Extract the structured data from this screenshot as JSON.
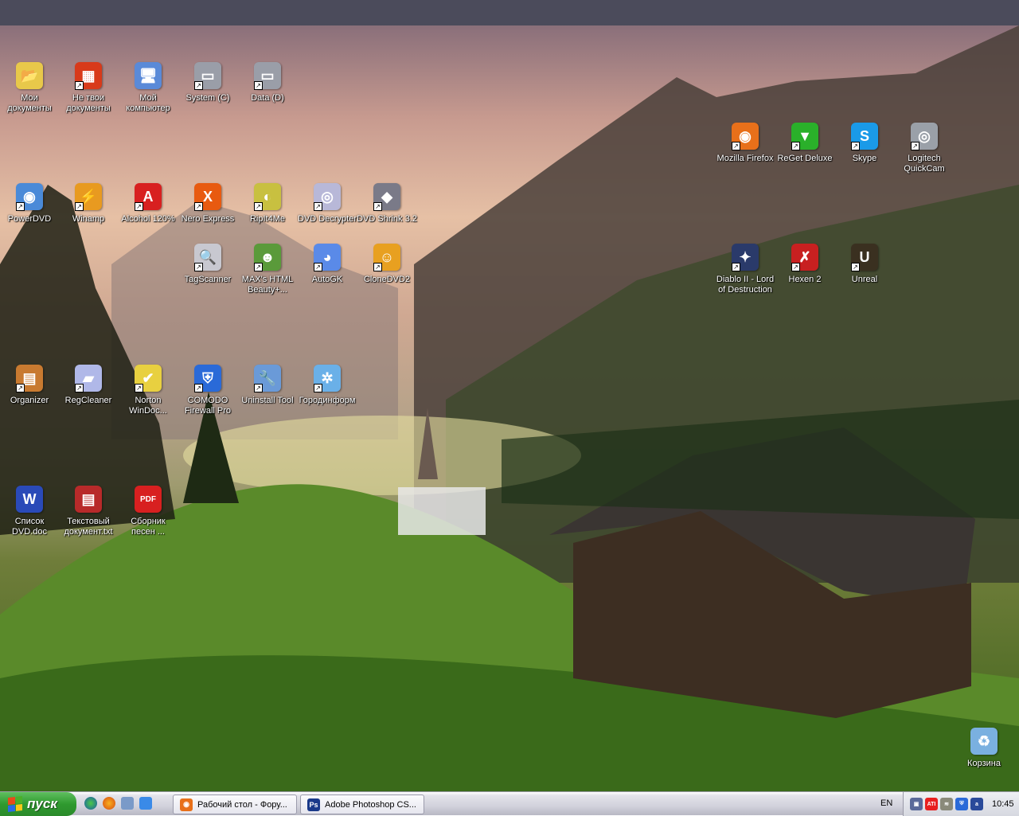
{
  "desktop_icons": [
    {
      "label": "Мои\nдокументы",
      "glyph": "📂",
      "color": "#e8c84a",
      "shortcut": false
    },
    {
      "label": "Не твои\nдокументы",
      "glyph": "▦",
      "color": "#d83a1a",
      "shortcut": true
    },
    {
      "label": "Мой\nкомпьютер",
      "glyph": "🖥",
      "color": "#5a8ad8",
      "shortcut": false
    },
    {
      "label": "System (C)",
      "glyph": "▭",
      "color": "#9a9ea8",
      "shortcut": true
    },
    {
      "label": "Data (D)",
      "glyph": "▭",
      "color": "#9a9ea8",
      "shortcut": true
    },
    {
      "label": "PowerDVD",
      "glyph": "◉",
      "color": "#4a8ad8",
      "shortcut": true
    },
    {
      "label": "Winamp",
      "glyph": "⚡",
      "color": "#e89a20",
      "shortcut": true
    },
    {
      "label": "Alcohol 120%",
      "glyph": "A",
      "color": "#d82020",
      "shortcut": true
    },
    {
      "label": "Nero Express",
      "glyph": "X",
      "color": "#e85a10",
      "shortcut": true
    },
    {
      "label": "RipIt4Me",
      "glyph": "◐",
      "color": "#c8c040",
      "shortcut": true
    },
    {
      "label": "DVD Decrypter",
      "glyph": "◎",
      "color": "#b8b8d8",
      "shortcut": true
    },
    {
      "label": "DVD Shrink 3.2",
      "glyph": "◆",
      "color": "#7a7a88",
      "shortcut": true
    },
    {
      "label": "TagScanner",
      "glyph": "🔍",
      "color": "#c8c8d0",
      "shortcut": true
    },
    {
      "label": "MAX's HTML\nBeauty+...",
      "glyph": "☻",
      "color": "#5a9a3a",
      "shortcut": true
    },
    {
      "label": "AutoGK",
      "glyph": "◕",
      "color": "#5a8ae8",
      "shortcut": true
    },
    {
      "label": "CloneDVD2",
      "glyph": "☺",
      "color": "#e8a020",
      "shortcut": true
    },
    {
      "label": "Organizer",
      "glyph": "▤",
      "color": "#c87a30",
      "shortcut": true
    },
    {
      "label": "RegCleaner",
      "glyph": "▰",
      "color": "#b0b8e8",
      "shortcut": true
    },
    {
      "label": "Norton\nWinDoc...",
      "glyph": "✔",
      "color": "#e8d040",
      "shortcut": true
    },
    {
      "label": "COMODO\nFirewall Pro",
      "glyph": "⛨",
      "color": "#2a6ad8",
      "shortcut": true
    },
    {
      "label": "Uninstall Tool",
      "glyph": "🔧",
      "color": "#6a9ad8",
      "shortcut": true
    },
    {
      "label": "Городинформ",
      "glyph": "✲",
      "color": "#6ab0e8",
      "shortcut": true
    },
    {
      "label": "Список\nDVD.doc",
      "glyph": "W",
      "color": "#2a4ab8",
      "shortcut": false
    },
    {
      "label": "Текстовый\nдокумент.txt",
      "glyph": "▤",
      "color": "#b82a2a",
      "shortcut": false
    },
    {
      "label": "Сборник\nпесен ...",
      "glyph": "PDF",
      "color": "#d82020",
      "shortcut": false
    },
    {
      "label": "Mozilla Firefox",
      "glyph": "◉",
      "color": "#e8701a",
      "shortcut": true
    },
    {
      "label": "ReGet Deluxe",
      "glyph": "▼",
      "color": "#2ab02a",
      "shortcut": true
    },
    {
      "label": "Skype",
      "glyph": "S",
      "color": "#1a9ae8",
      "shortcut": true
    },
    {
      "label": "Logitech\nQuickCam",
      "glyph": "◎",
      "color": "#9aa0a8",
      "shortcut": true
    },
    {
      "label": "Diablo II - Lord\nof Destruction",
      "glyph": "✦",
      "color": "#2a3a6a",
      "shortcut": true
    },
    {
      "label": "Hexen 2",
      "glyph": "✗",
      "color": "#c82020",
      "shortcut": true
    },
    {
      "label": "Unreal",
      "glyph": "U",
      "color": "#3a3020",
      "shortcut": true
    },
    {
      "label": "Корзина",
      "glyph": "♻",
      "color": "#7ab0e0",
      "shortcut": false
    }
  ],
  "taskbar": {
    "start_label": "пуск",
    "quick_launch": [
      "internet-icon",
      "firefox-icon",
      "network-icon",
      "edit-icon"
    ],
    "tasks": [
      {
        "label": "Рабочий стол - Фору...",
        "glyph": "◉",
        "color": "#e8701a"
      },
      {
        "label": "Adobe Photoshop CS...",
        "glyph": "Ps",
        "color": "#1a3a8a"
      }
    ],
    "language": "EN",
    "tray": [
      {
        "name": "network-tray-icon",
        "glyph": "▣",
        "color": "#5a6a9a"
      },
      {
        "name": "ati-tray-icon",
        "glyph": "ATI",
        "color": "#e82020"
      },
      {
        "name": "sound-tray-icon",
        "glyph": "≋",
        "color": "#8a8a7a"
      },
      {
        "name": "comodo-tray-icon",
        "glyph": "⛨",
        "color": "#2a6ad8"
      },
      {
        "name": "agent-tray-icon",
        "glyph": "a",
        "color": "#2a4a9a"
      }
    ],
    "clock": "10:45"
  }
}
